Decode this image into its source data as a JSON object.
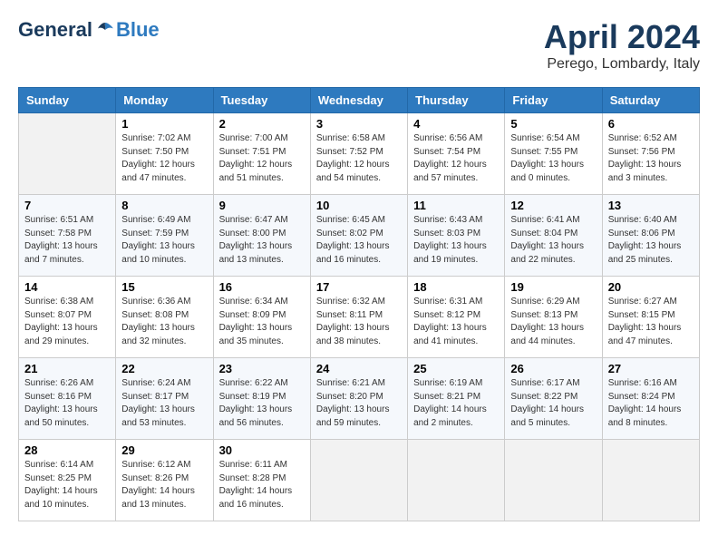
{
  "header": {
    "logo_general": "General",
    "logo_blue": "Blue",
    "month_title": "April 2024",
    "location": "Perego, Lombardy, Italy"
  },
  "weekdays": [
    "Sunday",
    "Monday",
    "Tuesday",
    "Wednesday",
    "Thursday",
    "Friday",
    "Saturday"
  ],
  "weeks": [
    [
      {
        "day": "",
        "sunrise": "",
        "sunset": "",
        "daylight": "",
        "empty": true
      },
      {
        "day": "1",
        "sunrise": "Sunrise: 7:02 AM",
        "sunset": "Sunset: 7:50 PM",
        "daylight": "Daylight: 12 hours and 47 minutes."
      },
      {
        "day": "2",
        "sunrise": "Sunrise: 7:00 AM",
        "sunset": "Sunset: 7:51 PM",
        "daylight": "Daylight: 12 hours and 51 minutes."
      },
      {
        "day": "3",
        "sunrise": "Sunrise: 6:58 AM",
        "sunset": "Sunset: 7:52 PM",
        "daylight": "Daylight: 12 hours and 54 minutes."
      },
      {
        "day": "4",
        "sunrise": "Sunrise: 6:56 AM",
        "sunset": "Sunset: 7:54 PM",
        "daylight": "Daylight: 12 hours and 57 minutes."
      },
      {
        "day": "5",
        "sunrise": "Sunrise: 6:54 AM",
        "sunset": "Sunset: 7:55 PM",
        "daylight": "Daylight: 13 hours and 0 minutes."
      },
      {
        "day": "6",
        "sunrise": "Sunrise: 6:52 AM",
        "sunset": "Sunset: 7:56 PM",
        "daylight": "Daylight: 13 hours and 3 minutes."
      }
    ],
    [
      {
        "day": "7",
        "sunrise": "Sunrise: 6:51 AM",
        "sunset": "Sunset: 7:58 PM",
        "daylight": "Daylight: 13 hours and 7 minutes."
      },
      {
        "day": "8",
        "sunrise": "Sunrise: 6:49 AM",
        "sunset": "Sunset: 7:59 PM",
        "daylight": "Daylight: 13 hours and 10 minutes."
      },
      {
        "day": "9",
        "sunrise": "Sunrise: 6:47 AM",
        "sunset": "Sunset: 8:00 PM",
        "daylight": "Daylight: 13 hours and 13 minutes."
      },
      {
        "day": "10",
        "sunrise": "Sunrise: 6:45 AM",
        "sunset": "Sunset: 8:02 PM",
        "daylight": "Daylight: 13 hours and 16 minutes."
      },
      {
        "day": "11",
        "sunrise": "Sunrise: 6:43 AM",
        "sunset": "Sunset: 8:03 PM",
        "daylight": "Daylight: 13 hours and 19 minutes."
      },
      {
        "day": "12",
        "sunrise": "Sunrise: 6:41 AM",
        "sunset": "Sunset: 8:04 PM",
        "daylight": "Daylight: 13 hours and 22 minutes."
      },
      {
        "day": "13",
        "sunrise": "Sunrise: 6:40 AM",
        "sunset": "Sunset: 8:06 PM",
        "daylight": "Daylight: 13 hours and 25 minutes."
      }
    ],
    [
      {
        "day": "14",
        "sunrise": "Sunrise: 6:38 AM",
        "sunset": "Sunset: 8:07 PM",
        "daylight": "Daylight: 13 hours and 29 minutes."
      },
      {
        "day": "15",
        "sunrise": "Sunrise: 6:36 AM",
        "sunset": "Sunset: 8:08 PM",
        "daylight": "Daylight: 13 hours and 32 minutes."
      },
      {
        "day": "16",
        "sunrise": "Sunrise: 6:34 AM",
        "sunset": "Sunset: 8:09 PM",
        "daylight": "Daylight: 13 hours and 35 minutes."
      },
      {
        "day": "17",
        "sunrise": "Sunrise: 6:32 AM",
        "sunset": "Sunset: 8:11 PM",
        "daylight": "Daylight: 13 hours and 38 minutes."
      },
      {
        "day": "18",
        "sunrise": "Sunrise: 6:31 AM",
        "sunset": "Sunset: 8:12 PM",
        "daylight": "Daylight: 13 hours and 41 minutes."
      },
      {
        "day": "19",
        "sunrise": "Sunrise: 6:29 AM",
        "sunset": "Sunset: 8:13 PM",
        "daylight": "Daylight: 13 hours and 44 minutes."
      },
      {
        "day": "20",
        "sunrise": "Sunrise: 6:27 AM",
        "sunset": "Sunset: 8:15 PM",
        "daylight": "Daylight: 13 hours and 47 minutes."
      }
    ],
    [
      {
        "day": "21",
        "sunrise": "Sunrise: 6:26 AM",
        "sunset": "Sunset: 8:16 PM",
        "daylight": "Daylight: 13 hours and 50 minutes."
      },
      {
        "day": "22",
        "sunrise": "Sunrise: 6:24 AM",
        "sunset": "Sunset: 8:17 PM",
        "daylight": "Daylight: 13 hours and 53 minutes."
      },
      {
        "day": "23",
        "sunrise": "Sunrise: 6:22 AM",
        "sunset": "Sunset: 8:19 PM",
        "daylight": "Daylight: 13 hours and 56 minutes."
      },
      {
        "day": "24",
        "sunrise": "Sunrise: 6:21 AM",
        "sunset": "Sunset: 8:20 PM",
        "daylight": "Daylight: 13 hours and 59 minutes."
      },
      {
        "day": "25",
        "sunrise": "Sunrise: 6:19 AM",
        "sunset": "Sunset: 8:21 PM",
        "daylight": "Daylight: 14 hours and 2 minutes."
      },
      {
        "day": "26",
        "sunrise": "Sunrise: 6:17 AM",
        "sunset": "Sunset: 8:22 PM",
        "daylight": "Daylight: 14 hours and 5 minutes."
      },
      {
        "day": "27",
        "sunrise": "Sunrise: 6:16 AM",
        "sunset": "Sunset: 8:24 PM",
        "daylight": "Daylight: 14 hours and 8 minutes."
      }
    ],
    [
      {
        "day": "28",
        "sunrise": "Sunrise: 6:14 AM",
        "sunset": "Sunset: 8:25 PM",
        "daylight": "Daylight: 14 hours and 10 minutes."
      },
      {
        "day": "29",
        "sunrise": "Sunrise: 6:12 AM",
        "sunset": "Sunset: 8:26 PM",
        "daylight": "Daylight: 14 hours and 13 minutes."
      },
      {
        "day": "30",
        "sunrise": "Sunrise: 6:11 AM",
        "sunset": "Sunset: 8:28 PM",
        "daylight": "Daylight: 14 hours and 16 minutes."
      },
      {
        "day": "",
        "sunrise": "",
        "sunset": "",
        "daylight": "",
        "empty": true
      },
      {
        "day": "",
        "sunrise": "",
        "sunset": "",
        "daylight": "",
        "empty": true
      },
      {
        "day": "",
        "sunrise": "",
        "sunset": "",
        "daylight": "",
        "empty": true
      },
      {
        "day": "",
        "sunrise": "",
        "sunset": "",
        "daylight": "",
        "empty": true
      }
    ]
  ]
}
